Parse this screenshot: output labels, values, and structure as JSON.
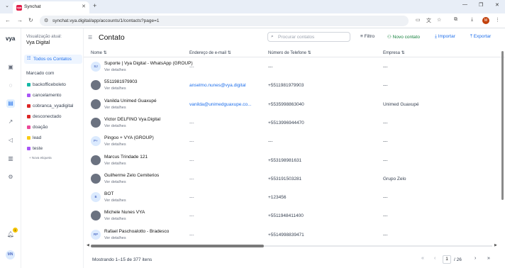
{
  "browser": {
    "tab_title": "Synchat",
    "favicon_text": "vya",
    "url": "synchat.vya.digital/app/accounts/1/contacts?page=1",
    "profile_initial": "M"
  },
  "rail": {
    "logo": "vya",
    "notification_count": "1",
    "avatar_initials": "MN"
  },
  "sidebar": {
    "view_label": "Visualização atual:",
    "view_name": "Vya Digital",
    "all_contacts": "Todos os Contatos",
    "marked_heading": "Marcado com",
    "labels": [
      {
        "name": "backofficeboleto",
        "color": "#14b8a6"
      },
      {
        "name": "cancelamento",
        "color": "#a855f7"
      },
      {
        "name": "cobranca_vyadigital",
        "color": "#dc2626"
      },
      {
        "name": "desconectado",
        "color": "#dc2626"
      },
      {
        "name": "doação",
        "color": "#ec4899"
      },
      {
        "name": "lead",
        "color": "#facc15"
      },
      {
        "name": "teste",
        "color": "#a855f7"
      }
    ],
    "new_label": "+ Nova etiqueta"
  },
  "main": {
    "title": "Contato",
    "search_placeholder": "Procurar contatos",
    "filter": "Filtro",
    "new_contact": "Novo contato",
    "import": "Importar",
    "export": "Exportar"
  },
  "table": {
    "headers": {
      "name": "Nome",
      "email": "Endereço de e-mail",
      "phone": "Número de Telefone",
      "company": "Empresa"
    },
    "details_label": "Ver detalhes",
    "rows": [
      {
        "initials": "SJ",
        "photo": false,
        "name": "Suporte | Vya Digital - WhatsApp (GROUP)",
        "email": "---",
        "email_link": false,
        "phone": "---",
        "company": "---"
      },
      {
        "initials": "",
        "photo": true,
        "name": "5511981979903",
        "email": "anselmo.nunes@vya.digital",
        "email_link": true,
        "phone": "+5511981979903",
        "company": "---"
      },
      {
        "initials": "",
        "photo": true,
        "name": "Vanilda Unimed Guaxupé",
        "email": "vanilda@unimedguaxupe.co...",
        "email_link": true,
        "phone": "+5535998863040",
        "company": "Unimed Guaxupé"
      },
      {
        "initials": "",
        "photo": true,
        "name": "Victor DELFINO Vya.Digital",
        "email": "---",
        "email_link": false,
        "phone": "+5513996944470",
        "company": "---"
      },
      {
        "initials": "P+",
        "photo": false,
        "name": "Pingoo + VYA (GROUP)",
        "email": "---",
        "email_link": false,
        "phone": "---",
        "company": "---"
      },
      {
        "initials": "",
        "photo": true,
        "name": "Marcus Trindade 121",
        "email": "---",
        "email_link": false,
        "phone": "+553198981631",
        "company": "---"
      },
      {
        "initials": "",
        "photo": true,
        "name": "Guilherme Zelo Cemiterios",
        "email": "---",
        "email_link": false,
        "phone": "+553191503281",
        "company": "Grupo Zelo"
      },
      {
        "initials": "B",
        "photo": false,
        "name": "BOT",
        "email": "---",
        "email_link": false,
        "phone": "+123456",
        "company": "---"
      },
      {
        "initials": "",
        "photo": true,
        "name": "Michele Nunes VYA",
        "email": "---",
        "email_link": false,
        "phone": "+5511948411400",
        "company": "---"
      },
      {
        "initials": "RP",
        "photo": false,
        "name": "Rafael Paschoalotto - Bradesco",
        "email": "---",
        "email_link": false,
        "phone": "+5514998839471",
        "company": "---"
      }
    ]
  },
  "footer": {
    "showing": "Mostrando 1–15 de 377 itens",
    "current_page": "1",
    "total_pages": "/ 26"
  }
}
